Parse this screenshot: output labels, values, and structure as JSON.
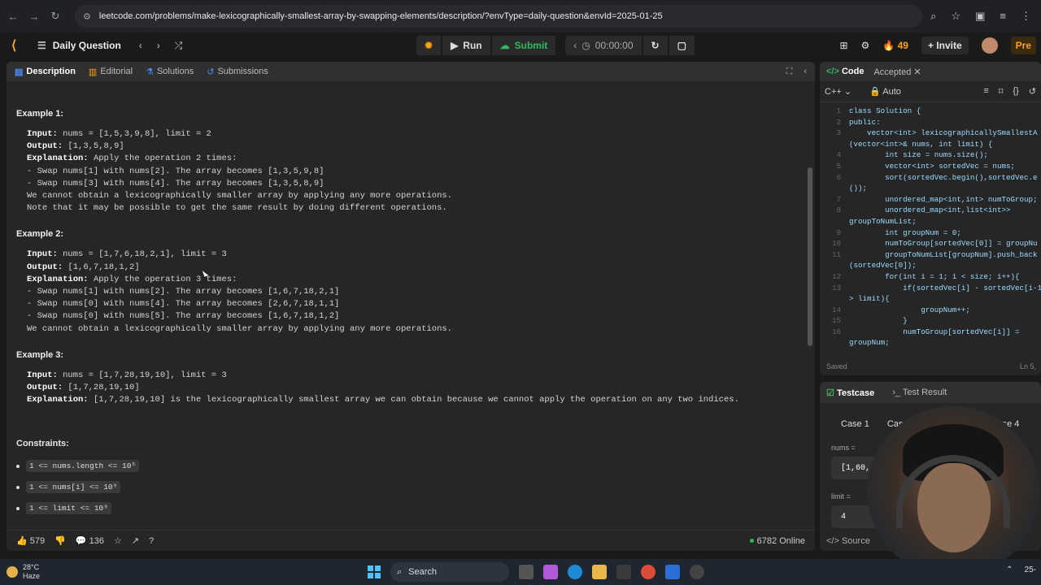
{
  "browser": {
    "url": "leetcode.com/problems/make-lexicographically-smallest-array-by-swapping-elements/description/?envType=daily-question&envId=2025-01-25"
  },
  "topbar": {
    "title": "Daily Question",
    "run": "Run",
    "submit": "Submit",
    "timer": "00:00:00",
    "streak": "49",
    "invite": "Invite",
    "premium": "Pre"
  },
  "tabs": {
    "description": "Description",
    "editorial": "Editorial",
    "solutions": "Solutions",
    "submissions": "Submissions"
  },
  "examples": [
    {
      "title": "Example 1:",
      "input": "nums = [1,5,3,9,8], limit = 2",
      "output": "[1,3,5,8,9]",
      "explanation": "Apply the operation 2 times:",
      "lines": [
        "- Swap nums[1] with nums[2]. The array becomes [1,3,5,9,8]",
        "- Swap nums[3] with nums[4]. The array becomes [1,3,5,8,9]",
        "We cannot obtain a lexicographically smaller array by applying any more operations.",
        "Note that it may be possible to get the same result by doing different operations."
      ]
    },
    {
      "title": "Example 2:",
      "input": "nums = [1,7,6,18,2,1], limit = 3",
      "output": "[1,6,7,18,1,2]",
      "explanation": "Apply the operation 3 times:",
      "lines": [
        "- Swap nums[1] with nums[2]. The array becomes [1,6,7,18,2,1]",
        "- Swap nums[0] with nums[4]. The array becomes [2,6,7,18,1,1]",
        "- Swap nums[0] with nums[5]. The array becomes [1,6,7,18,1,2]",
        "We cannot obtain a lexicographically smaller array by applying any more operations."
      ]
    },
    {
      "title": "Example 3:",
      "input": "nums = [1,7,28,19,10], limit = 3",
      "output": "[1,7,28,19,10]",
      "explanation": "[1,7,28,19,10] is the lexicographically smallest array we can obtain because we cannot apply the operation on any two indices.",
      "lines": []
    }
  ],
  "labels": {
    "input": "Input:",
    "output": "Output:",
    "explanation": "Explanation:"
  },
  "constraints": {
    "title": "Constraints:",
    "items": [
      "1 <= nums.length <= 10⁵",
      "1 <= nums[i] <= 10⁹",
      "1 <= limit <= 10⁹"
    ]
  },
  "footer": {
    "likes": "579",
    "comments": "136",
    "online": "6782 Online"
  },
  "code_panel": {
    "tab": "Code",
    "status": "Accepted",
    "lang": "C++",
    "mode": "Auto",
    "saved": "Saved",
    "pos": "Ln 5,",
    "lines": [
      {
        "n": "1",
        "t": "class Solution {"
      },
      {
        "n": "2",
        "t": "public:"
      },
      {
        "n": "3",
        "t": "    vector<int> lexicographicallySmallestA"
      },
      {
        "n": "",
        "t": "(vector<int>& nums, int limit) {"
      },
      {
        "n": "4",
        "t": "        int size = nums.size();"
      },
      {
        "n": "5",
        "t": "        vector<int> sortedVec = nums;"
      },
      {
        "n": "6",
        "t": "        sort(sortedVec.begin(),sortedVec.e"
      },
      {
        "n": "",
        "t": "());"
      },
      {
        "n": "7",
        "t": "        unordered_map<int,int> numToGroup;"
      },
      {
        "n": "8",
        "t": "        unordered_map<int,list<int>>"
      },
      {
        "n": "",
        "t": "groupToNumList;"
      },
      {
        "n": "9",
        "t": "        int groupNum = 0;"
      },
      {
        "n": "10",
        "t": "        numToGroup[sortedVec[0]] = groupNu"
      },
      {
        "n": "11",
        "t": "        groupToNumList[groupNum].push_back"
      },
      {
        "n": "",
        "t": "(sortedVec[0]);"
      },
      {
        "n": "12",
        "t": "        for(int i = 1; i < size; i++){"
      },
      {
        "n": "13",
        "t": "            if(sortedVec[i] - sortedVec[i-1"
      },
      {
        "n": "",
        "t": "> limit){"
      },
      {
        "n": "14",
        "t": "                groupNum++;"
      },
      {
        "n": "15",
        "t": "            }"
      },
      {
        "n": "16",
        "t": "            numToGroup[sortedVec[i]] ="
      },
      {
        "n": "",
        "t": "groupNum;"
      }
    ]
  },
  "testcase": {
    "tab": "Testcase",
    "result_tab": "Test Result",
    "cases": [
      "Case 1",
      "Case",
      "Case 4"
    ],
    "nums_label": "nums =",
    "nums_value": "[1,60,",
    "limit_label": "limit =",
    "limit_value": "4",
    "source": "Source"
  },
  "taskbar": {
    "temp": "28°C",
    "weather": "Haze",
    "search": "Search",
    "time": "25-"
  }
}
